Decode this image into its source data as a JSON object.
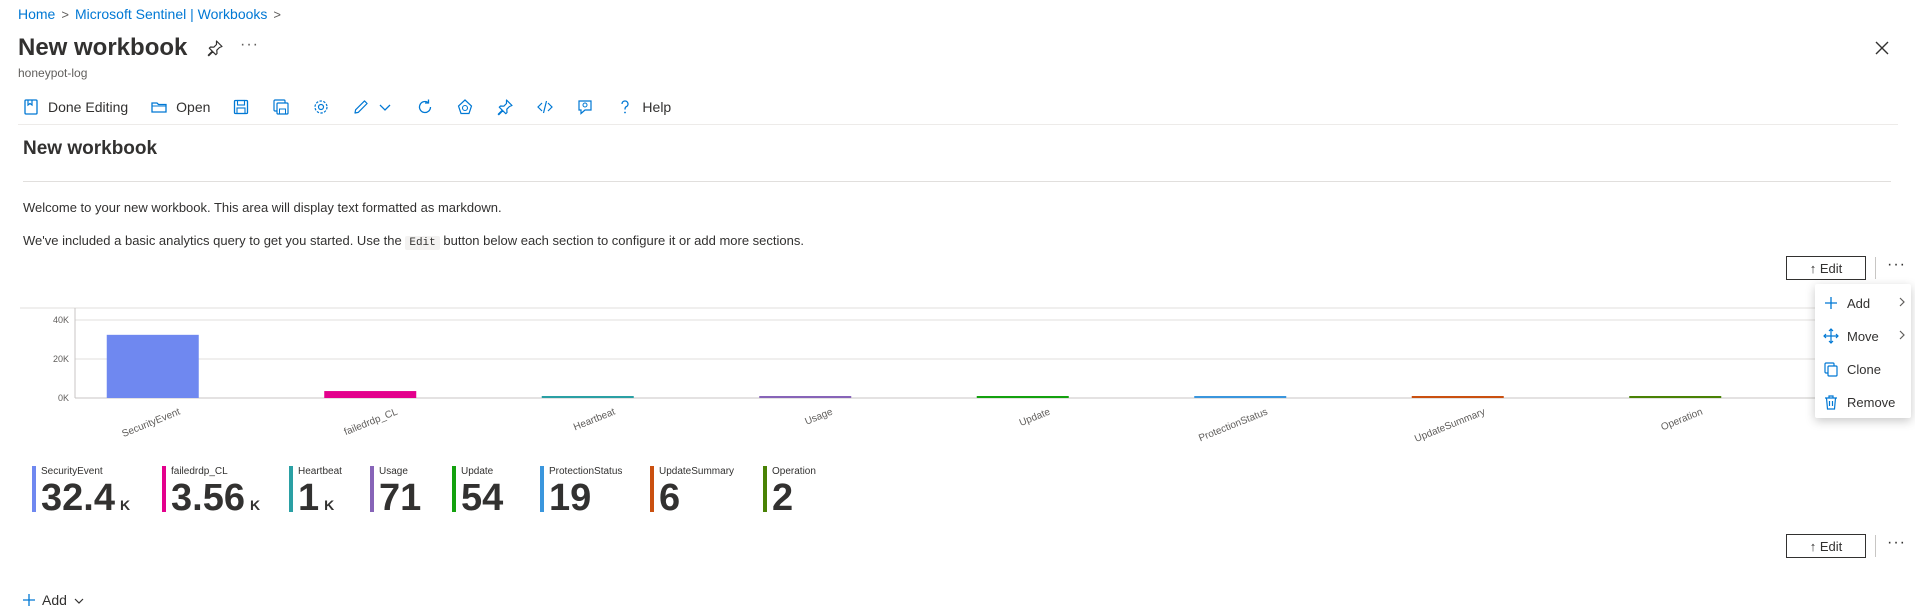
{
  "breadcrumb": {
    "home": "Home",
    "sentinel": "Microsoft Sentinel | Workbooks",
    "sep1": ">",
    "sep2": ">"
  },
  "header": {
    "title": "New workbook",
    "subtitle": "honeypot-log",
    "more": "···"
  },
  "toolbar": {
    "done_editing": "Done Editing",
    "open": "Open",
    "help": "Help"
  },
  "workbook": {
    "title": "New workbook",
    "text1": "Welcome to your new workbook. This area will display text formatted as markdown.",
    "text2_before": "We've included a basic analytics query to get you started. Use the",
    "text2_code": "Edit",
    "text2_after": "button below each section to configure it or add more sections.",
    "edit_label": "↑ Edit",
    "more": "···"
  },
  "context_menu": {
    "add": "Add",
    "move": "Move",
    "clone": "Clone",
    "remove": "Remove"
  },
  "chart_data": {
    "type": "bar",
    "categories": [
      "SecurityEvent",
      "failedrdp_CL",
      "Heartbeat",
      "Usage",
      "Update",
      "ProtectionStatus",
      "UpdateSummary",
      "Operation"
    ],
    "values": [
      32400,
      3560,
      1000,
      71,
      54,
      19,
      6,
      2
    ],
    "colors": [
      "#6f88f0",
      "#e3008c",
      "#2aa0a4",
      "#8764b8",
      "#13a10e",
      "#3a96dd",
      "#ca5010",
      "#498205"
    ],
    "yticks": [
      "0K",
      "20K",
      "40K"
    ],
    "ylim": [
      0,
      40000
    ],
    "title": "",
    "xlabel": "",
    "ylabel": ""
  },
  "tiles": [
    {
      "name": "SecurityEvent",
      "value": "32.4",
      "unit": "K",
      "color": "#6f88f0"
    },
    {
      "name": "failedrdp_CL",
      "value": "3.56",
      "unit": "K",
      "color": "#e3008c"
    },
    {
      "name": "Heartbeat",
      "value": "1",
      "unit": "K",
      "color": "#2aa0a4"
    },
    {
      "name": "Usage",
      "value": "71",
      "unit": "",
      "color": "#8764b8"
    },
    {
      "name": "Update",
      "value": "54",
      "unit": "",
      "color": "#13a10e"
    },
    {
      "name": "ProtectionStatus",
      "value": "19",
      "unit": "",
      "color": "#3a96dd"
    },
    {
      "name": "UpdateSummary",
      "value": "6",
      "unit": "",
      "color": "#ca5010"
    },
    {
      "name": "Operation",
      "value": "2",
      "unit": "",
      "color": "#498205"
    }
  ],
  "footer": {
    "add_label": "Add"
  },
  "icons": {
    "toolbar": [
      "save-icon",
      "save-as-icon",
      "settings-icon",
      "edit-icon",
      "refresh-icon",
      "auto-refresh-icon",
      "pin-icon",
      "code-icon",
      "feedback-icon",
      "help-icon"
    ]
  }
}
